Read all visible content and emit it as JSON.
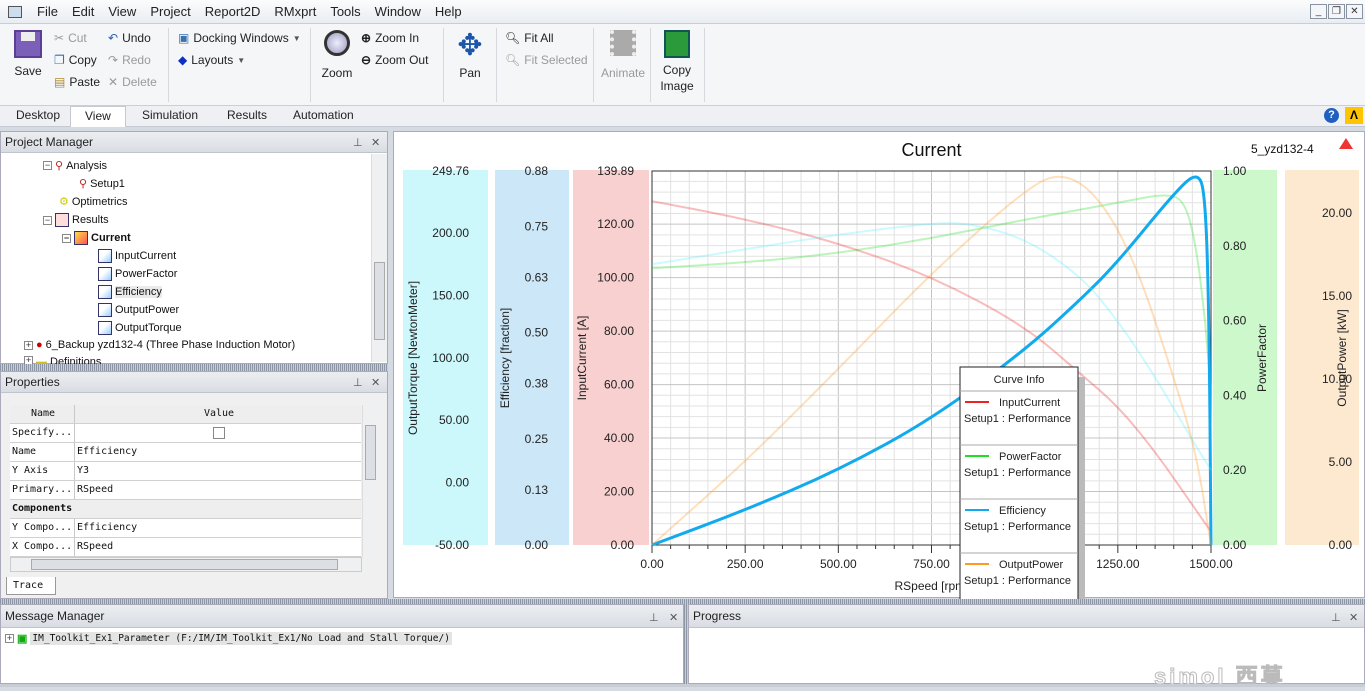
{
  "menu": [
    "File",
    "Edit",
    "View",
    "Project",
    "Report2D",
    "RMxprt",
    "Tools",
    "Window",
    "Help"
  ],
  "ribbon": {
    "save": "Save",
    "cut": "Cut",
    "copy": "Copy",
    "paste": "Paste",
    "undo": "Undo",
    "redo": "Redo",
    "delete": "Delete",
    "docking_windows": "Docking Windows",
    "layouts": "Layouts",
    "zoom": "Zoom",
    "zoom_in": "Zoom In",
    "zoom_out": "Zoom Out",
    "pan": "Pan",
    "fit_all": "Fit All",
    "fit_selected": "Fit Selected",
    "animate": "Animate",
    "copy_image": "Copy Image"
  },
  "tabs": [
    {
      "label": "Desktop"
    },
    {
      "label": "View",
      "active": true
    },
    {
      "label": "Simulation"
    },
    {
      "label": "Results"
    },
    {
      "label": "Automation"
    }
  ],
  "project_manager": {
    "title": "Project Manager",
    "items": [
      "Analysis",
      "Setup1",
      "Optimetrics",
      "Results",
      "Current",
      "InputCurrent",
      "PowerFactor",
      "Efficiency",
      "OutputPower",
      "OutputTorque",
      "6_Backup yzd132-4 (Three Phase Induction Motor)",
      "Definitions"
    ],
    "selected": "Efficiency"
  },
  "properties": {
    "title": "Properties",
    "headers": [
      "Name",
      "Value"
    ],
    "rows": [
      {
        "name": "Specify...",
        "value": ""
      },
      {
        "name": "Name",
        "value": "Efficiency"
      },
      {
        "name": "Y Axis",
        "value": "Y3"
      },
      {
        "name": "Primary...",
        "value": "RSpeed"
      },
      {
        "name": "Components",
        "value": ""
      },
      {
        "name": "Y Compo...",
        "value": "Efficiency"
      },
      {
        "name": "X Compo...",
        "value": "RSpeed"
      }
    ],
    "tab": "Trace"
  },
  "message_manager": {
    "title": "Message Manager",
    "item": "IM_Toolkit_Ex1_Parameter (F:/IM/IM_Toolkit_Ex1/No Load and Stall Torque/)"
  },
  "progress": {
    "title": "Progress"
  },
  "watermark": "simol 西莫",
  "chart_data": {
    "type": "line",
    "title": "Current",
    "design_label": "5_yzd132-4",
    "xlabel": "RSpeed [rpm]",
    "xlim": [
      0,
      1500
    ],
    "xticks": [
      "0.00",
      "250.00",
      "500.00",
      "750.00",
      "1000.00",
      "1250.00",
      "1500.00"
    ],
    "grid": true,
    "legend": {
      "title": "Curve Info",
      "placement": "bottom-right"
    },
    "axes": [
      {
        "id": "Y5",
        "label": "OutputTorque [NewtonMeter]",
        "range": [
          -50,
          249.76
        ],
        "ticks": [
          "-50.00",
          "0.00",
          "50.00",
          "100.00",
          "150.00",
          "200.00",
          "249.76"
        ],
        "band_color": "#ccf7fb"
      },
      {
        "id": "Y3",
        "label": "Efficiency [fraction]",
        "range": [
          0,
          0.88
        ],
        "ticks": [
          "0.00",
          "0.13",
          "0.25",
          "0.38",
          "0.50",
          "0.63",
          "0.75",
          "0.88"
        ],
        "band_color": "#cce8f8"
      },
      {
        "id": "Y1",
        "label": "InputCurrent [A]",
        "range": [
          0,
          139.89
        ],
        "ticks": [
          "0.00",
          "20.00",
          "40.00",
          "60.00",
          "80.00",
          "100.00",
          "120.00",
          "139.89"
        ],
        "band_color": "#f8d0d0"
      },
      {
        "id": "Y2",
        "label": "PowerFactor",
        "range": [
          0,
          1
        ],
        "ticks": [
          "0.00",
          "0.20",
          "0.40",
          "0.60",
          "0.80",
          "1.00"
        ],
        "band_color": "#ccf8cc"
      },
      {
        "id": "Y4",
        "label": "OutputPower [kW]",
        "range": [
          0,
          22.53
        ],
        "ticks": [
          "0.00",
          "5.00",
          "10.00",
          "15.00",
          "20.00"
        ],
        "band_color": "#fde8d0"
      }
    ],
    "series": [
      {
        "name": "InputCurrent",
        "source": "Setup1 : Performance",
        "axis": 2,
        "color": "#ee2222",
        "x": [
          0,
          250,
          500,
          750,
          1000,
          1150,
          1250,
          1350,
          1450,
          1500
        ],
        "y": [
          128.6,
          122,
          113,
          100.5,
          82,
          64,
          52,
          35,
          15,
          5
        ]
      },
      {
        "name": "PowerFactor",
        "source": "Setup1 : Performance",
        "axis": 3,
        "color": "#22dd22",
        "x": [
          0,
          250,
          500,
          750,
          1000,
          1250,
          1380,
          1430,
          1460,
          1485,
          1500
        ],
        "y": [
          0.74,
          0.755,
          0.78,
          0.82,
          0.87,
          0.915,
          0.94,
          0.92,
          0.8,
          0.6,
          0.4
        ]
      },
      {
        "name": "Efficiency",
        "source": "Setup1 : Performance",
        "axis": 1,
        "color": "#11aaee",
        "selected": true,
        "x": [
          0,
          250,
          500,
          750,
          1000,
          1154,
          1250,
          1400,
          1465,
          1485,
          1495,
          1500
        ],
        "y": [
          0,
          0.082,
          0.176,
          0.296,
          0.458,
          0.581,
          0.666,
          0.827,
          0.88,
          0.82,
          0.53,
          0
        ]
      },
      {
        "name": "OutputPower",
        "source": "Setup1 : Performance",
        "axis": 4,
        "color": "#ff9922",
        "x": [
          0,
          250,
          500,
          750,
          1000,
          1100,
          1200,
          1300,
          1400,
          1460,
          1500
        ],
        "y": [
          0,
          5,
          10.6,
          16.4,
          21.4,
          22.5,
          21,
          16.9,
          10.1,
          5.6,
          0
        ]
      },
      {
        "name": "OutputTorque",
        "axis": 0,
        "color": "#55eeff",
        "x": [
          0,
          250,
          500,
          750,
          850,
          1000,
          1150,
          1250,
          1350,
          1450,
          1500
        ],
        "y": [
          175,
          187,
          199,
          208,
          208,
          196,
          166,
          130,
          85,
          34,
          10
        ]
      }
    ]
  }
}
